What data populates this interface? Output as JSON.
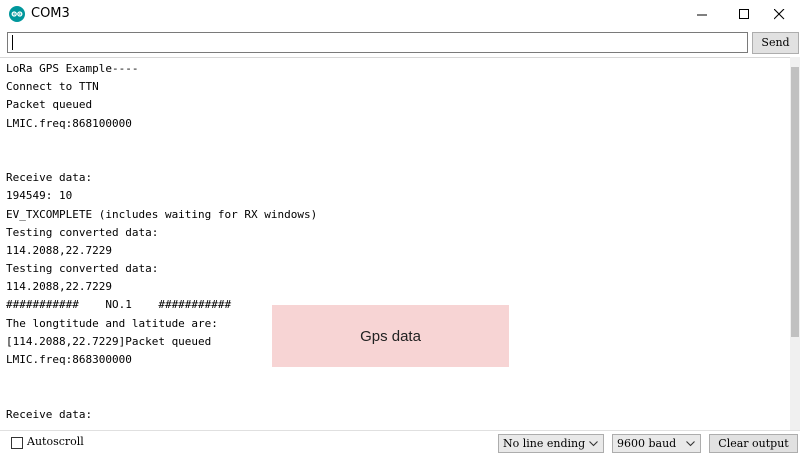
{
  "window": {
    "title": "COM3",
    "app_icon": "arduino-logo-icon",
    "controls": [
      "minimize-icon",
      "maximize-icon",
      "close-icon"
    ]
  },
  "toolbar": {
    "input_value": "",
    "send_label": "Send"
  },
  "output": {
    "lines": [
      "LoRa GPS Example----",
      "Connect to TTN",
      "Packet queued",
      "LMIC.freq:868100000",
      "",
      "",
      "Receive data:",
      "194549: 10",
      "EV_TXCOMPLETE (includes waiting for RX windows)",
      "Testing converted data:",
      "114.2088,22.7229",
      "Testing converted data:",
      "114.2088,22.7229",
      "###########    NO.1    ###########",
      "The longtitude and latitude are:",
      "[114.2088,22.7229]Packet queued",
      "LMIC.freq:868300000",
      "",
      "",
      "Receive data:"
    ]
  },
  "annotation": {
    "label": "Gps data",
    "color": "#f7d4d4"
  },
  "statusbar": {
    "autoscroll_label": "Autoscroll",
    "autoscroll_checked": false,
    "line_ending": "No line ending",
    "baud": "9600 baud",
    "clear_label": "Clear output"
  },
  "colors": {
    "app_icon": "#00979c",
    "button_bg": "#e1e1e1"
  }
}
